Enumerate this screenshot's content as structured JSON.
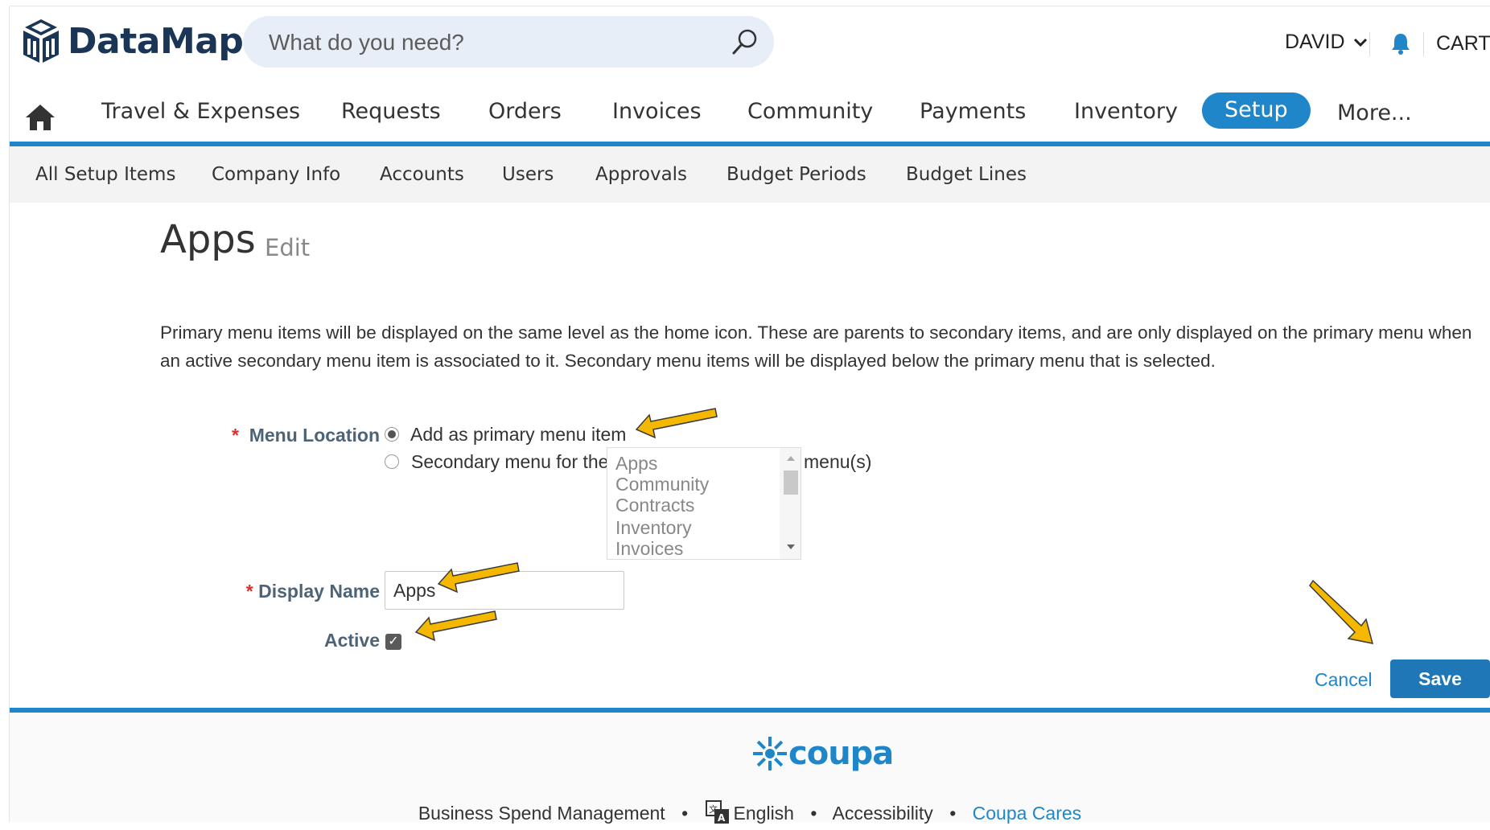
{
  "header": {
    "logo_text": "DataMap",
    "search_placeholder": "What do you need?",
    "user_name": "DAVID",
    "cart_label": "CART"
  },
  "primary_nav": {
    "items": [
      {
        "label": "Travel & Expenses"
      },
      {
        "label": "Requests"
      },
      {
        "label": "Orders"
      },
      {
        "label": "Invoices"
      },
      {
        "label": "Community"
      },
      {
        "label": "Payments"
      },
      {
        "label": "Inventory"
      },
      {
        "label": "Setup",
        "active": true
      },
      {
        "label": "More..."
      }
    ]
  },
  "secondary_nav": {
    "items": [
      {
        "label": "All Setup Items"
      },
      {
        "label": "Company Info"
      },
      {
        "label": "Accounts"
      },
      {
        "label": "Users"
      },
      {
        "label": "Approvals"
      },
      {
        "label": "Budget Periods"
      },
      {
        "label": "Budget Lines"
      }
    ]
  },
  "page": {
    "title": "Apps",
    "subtitle": "Edit",
    "description": "Primary menu items will be displayed on the same level as the home icon. These are parents to secondary items, and are only displayed on the primary menu when an active secondary menu item is associated to it. Secondary menu items will be displayed below the primary menu that is selected."
  },
  "form": {
    "required_marker": "*",
    "menu_location_label": "Menu Location",
    "option_primary": "Add as primary menu item",
    "option_secondary": "Secondary menu for the",
    "menu_options": [
      "Apps",
      "Community",
      "Contracts",
      "Inventory",
      "Invoices"
    ],
    "menus_suffix": "menu(s)",
    "selected_option": "primary",
    "display_name_label": "Display Name",
    "display_name_value": "Apps",
    "active_label": "Active",
    "active_checked": true,
    "cancel_label": "Cancel",
    "save_label": "Save"
  },
  "footer": {
    "brand": "coupa",
    "links": [
      "Business Spend Management",
      "English",
      "Accessibility",
      "Coupa Cares"
    ],
    "separator": "•"
  },
  "colors": {
    "accent": "#1f87c9",
    "save_button": "#1f77b8",
    "brand_dark": "#1b3557",
    "required": "#d9302c",
    "annotation_arrow": "#f5b800"
  },
  "icons": {
    "logo": "cube-logo-icon",
    "search": "search-icon",
    "user_menu": "chevron-down-icon",
    "notifications": "bell-icon",
    "home": "home-icon",
    "language": "translate-icon",
    "annotation": "arrow-annotation-icon"
  }
}
